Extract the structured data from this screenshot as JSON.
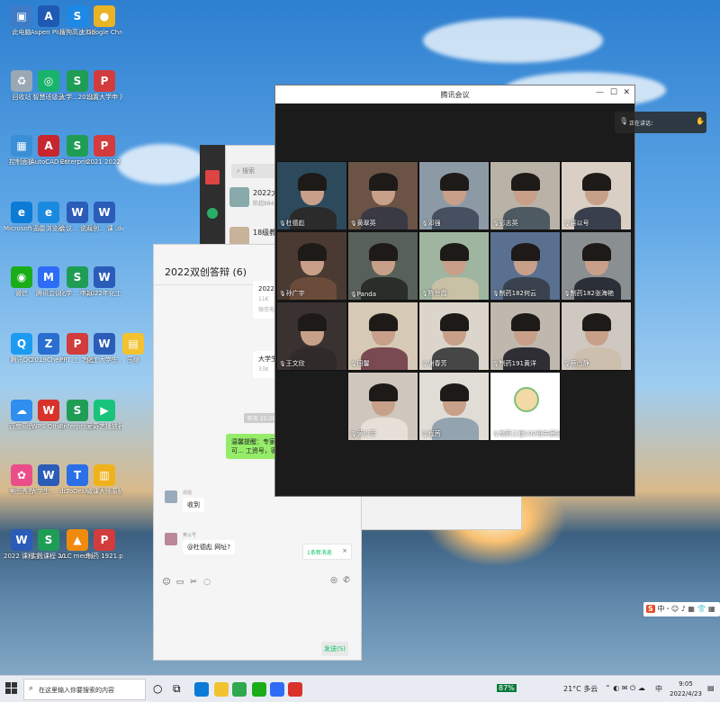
{
  "desktop": {
    "icons": [
      {
        "label": "此电脑",
        "color": "#3f7cc7",
        "glyph": "▣"
      },
      {
        "label": "Aspen Plus V11",
        "color": "#1e5ab4",
        "glyph": "A"
      },
      {
        "label": "搜狗高速浏览器",
        "color": "#1e88e5",
        "glyph": "S"
      },
      {
        "label": "Google Chrome",
        "color": "#e8b423",
        "glyph": "●"
      },
      {
        "label": "回收站",
        "color": "#9aa8b4",
        "glyph": "♻"
      },
      {
        "label": "智慧班级云",
        "color": "#19b36b",
        "glyph": "◎"
      },
      {
        "label": "大学...2021新 届课...",
        "color": "#1f9d55",
        "glyph": "S"
      },
      {
        "label": "设置大学申 报书.pdf",
        "color": "#d23c3c",
        "glyph": "P"
      },
      {
        "label": "控制面板",
        "color": "#3a8fd6",
        "glyph": "▦"
      },
      {
        "label": "AutoCAD 2019 - 简...",
        "color": "#c8262f",
        "glyph": "A"
      },
      {
        "label": "Enterpris...",
        "color": "#1f9d55",
        "glyph": "S"
      },
      {
        "label": "2021 2022... 创新项目...",
        "color": "#d23c3c",
        "glyph": "P"
      },
      {
        "label": "Microsoft Edge",
        "color": "#0b7bd6",
        "glyph": "e"
      },
      {
        "label": "迅雷浏览器",
        "color": "#1a8ae0",
        "glyph": "e"
      },
      {
        "label": "会议... 说明 请查看...",
        "color": "#2a5cb8",
        "glyph": "W"
      },
      {
        "label": "双创... 课 .docx",
        "color": "#2a5cb8",
        "glyph": "W"
      },
      {
        "label": "微信",
        "color": "#1aad19",
        "glyph": "◉"
      },
      {
        "label": "腾讯会议",
        "color": "#2d6cf6",
        "glyph": "M"
      },
      {
        "label": "化学... 申报 书模板...",
        "color": "#1f9d55",
        "glyph": "S"
      },
      {
        "label": "2022年化工 工艺设计...",
        "color": "#2a5cb8",
        "glyph": "W"
      },
      {
        "label": "腾讯QQ",
        "color": "#1d9bf0",
        "glyph": "Q"
      },
      {
        "label": "2019ChemDraw 预订...",
        "color": "#2a6fd0",
        "glyph": "Z"
      },
      {
        "label": "PPT 工 艺设计.pdf",
        "color": "#d23c3c",
        "glyph": "P"
      },
      {
        "label": "化工大学生... .docx",
        "color": "#2a5cb8",
        "glyph": "W"
      },
      {
        "label": "压缩",
        "color": "#f2c230",
        "glyph": "▤"
      },
      {
        "label": "百度网盘",
        "color": "#2f8ef0",
        "glyph": "☁"
      },
      {
        "label": "WPS Office",
        "color": "#d8322a",
        "glyph": "W"
      },
      {
        "label": "Enterprise... 简书 .xls",
        "color": "#1f9d55",
        "glyph": "S"
      },
      {
        "label": "爱奇艺播放器",
        "color": "#18c47a",
        "glyph": "▶"
      },
      {
        "label": "美图秀秀",
        "color": "#e94e8a",
        "glyph": "✿"
      },
      {
        "label": "大学生... .docx",
        "color": "#2a5cb8",
        "glyph": "W"
      },
      {
        "label": "ToDesk",
        "color": "#2a6fe8",
        "glyph": "T"
      },
      {
        "label": "微课大师系统",
        "color": "#f0b21c",
        "glyph": "▥"
      },
      {
        "label": "2022 课程 实践大纲...",
        "color": "#2a5cb8",
        "glyph": "W"
      },
      {
        "label": "实践课程 2022实践...",
        "color": "#1f9d55",
        "glyph": "S"
      },
      {
        "label": "VLC media player",
        "color": "#f08a0c",
        "glyph": "▲"
      },
      {
        "label": "制药 1921.pdf",
        "color": "#d23c3c",
        "glyph": "P"
      }
    ]
  },
  "wechat_list": {
    "search_placeholder": "搜索",
    "chats": [
      {
        "title": "2022大创答辩",
        "snippet": "陈超8844: 李导..."
      },
      {
        "title": "18级教秘",
        "snippet": ""
      }
    ]
  },
  "group_chat": {
    "title": "2022双创答辩 (6)",
    "file1": {
      "name": "2022年@...排表.xlsx",
      "size": "11K",
      "source": "微信电脑版"
    },
    "file2": {
      "name": "大学生@...计划项目...",
      "size": "33K"
    },
    "timestamp": "昨天 21:28",
    "green_message": "温馨提醒：专家们可... 明天答辩结束以后可... 工资号，密码是123...",
    "msg1": {
      "sender": "邓强",
      "text": "收到"
    },
    "msg2": {
      "sender": "黄以号",
      "text": "@杜德彪 网址?"
    },
    "new_message": "1条新消息",
    "send_label": "发送(S)"
  },
  "meeting": {
    "title": "腾讯会议",
    "speaking_label": "正在讲话：",
    "participants": [
      {
        "name": "杜德彪",
        "bg": "#2d4a5c",
        "shirt": "#2b2b2b",
        "muted": false,
        "host": true
      },
      {
        "name": "黄翠英",
        "bg": "#6b5446",
        "shirt": "#3a3a44",
        "muted": true
      },
      {
        "name": "邓强",
        "bg": "#8c9aa6",
        "shirt": "#465060",
        "muted": true
      },
      {
        "name": "彭志英",
        "bg": "#b9b2a6",
        "shirt": "#4e5a62",
        "muted": true
      },
      {
        "name": "蒋以号",
        "bg": "#d9cfc4",
        "shirt": "#3a3f4d",
        "muted": true
      },
      {
        "name": "孙广宇",
        "bg": "#4a3a32",
        "shirt": "#6b4c3a",
        "muted": true
      },
      {
        "name": "Panda",
        "bg": "#58605a",
        "shirt": "#2a2e2a",
        "muted": true
      },
      {
        "name": "陈世霞",
        "bg": "#9fb5a0",
        "shirt": "#c9c1a5",
        "muted": true
      },
      {
        "name": "制药182何云",
        "bg": "#5a7090",
        "shirt": "#39424e",
        "muted": true
      },
      {
        "name": "制药182张海艳",
        "bg": "#8a8f92",
        "shirt": "#2b2f38",
        "muted": true
      },
      {
        "name": "王文欣",
        "bg": "#3a3230",
        "shirt": "#302a2a",
        "muted": true
      },
      {
        "name": "田馨",
        "bg": "#d6c9b6",
        "shirt": "#7a4a52",
        "muted": false
      },
      {
        "name": "谢春芳",
        "bg": "#dcd5cb",
        "shirt": "#464646",
        "muted": true
      },
      {
        "name": "制药191黄洋",
        "bg": "#c0b8ae",
        "shirt": "#2e2e34",
        "muted": true
      },
      {
        "name": "蔡山静",
        "bg": "#cfc8c0",
        "shirt": "#cdbfae",
        "muted": false
      },
      {
        "name": "黄小芳",
        "bg": "#cfc7be",
        "shirt": "#e6e0d8",
        "muted": true
      },
      {
        "name": "程茜",
        "bg": "#e0dcd6",
        "shirt": "#93a3b0",
        "muted": true
      },
      {
        "name": "制药工程192班朱雁妃",
        "bg": "#ffffff",
        "shirt": "#ffffff",
        "muted": true,
        "avatar": true
      }
    ]
  },
  "ime": {
    "label": "中",
    "items": "ꞏ ☺ ♪ ▦ 👕 ▦"
  },
  "taskbar": {
    "search_placeholder": "在这里输入你要搜索的内容",
    "battery": "87%",
    "weather": "21°C 多云",
    "time": "9:05",
    "date": "2022/4/23",
    "lang": "中"
  }
}
